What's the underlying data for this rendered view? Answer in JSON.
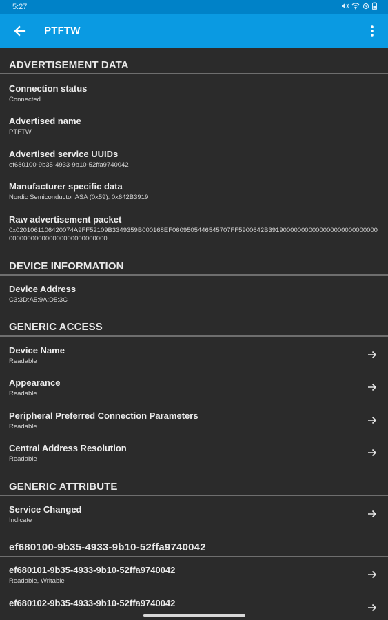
{
  "status_bar": {
    "time": "5:27"
  },
  "app_bar": {
    "title": "PTFTW"
  },
  "sections": {
    "advertisement": {
      "header": "ADVERTISEMENT DATA",
      "connection_status": {
        "title": "Connection status",
        "value": "Connected"
      },
      "advertised_name": {
        "title": "Advertised name",
        "value": "PTFTW"
      },
      "service_uuids": {
        "title": "Advertised service UUIDs",
        "value": "ef680100-9b35-4933-9b10-52ffa9740042"
      },
      "manufacturer_data": {
        "title": "Manufacturer specific data",
        "value": "Nordic Semiconductor ASA (0x59): 0x642B3919"
      },
      "raw_packet": {
        "title": "Raw advertisement packet",
        "value": "0x0201061106420074A9FF52109B3349359B000168EF0609505446545707FF5900642B391900000000000000000000000000000000000000000000000000000"
      }
    },
    "device_info": {
      "header": "DEVICE INFORMATION",
      "device_address": {
        "title": "Device Address",
        "value": "C3:3D:A5:9A:D5:3C"
      }
    },
    "generic_access": {
      "header": "GENERIC ACCESS",
      "items": [
        {
          "title": "Device Name",
          "value": "Readable"
        },
        {
          "title": "Appearance",
          "value": "Readable"
        },
        {
          "title": "Peripheral Preferred Connection Parameters",
          "value": "Readable"
        },
        {
          "title": "Central Address Resolution",
          "value": "Readable"
        }
      ]
    },
    "generic_attribute": {
      "header": "GENERIC ATTRIBUTE",
      "items": [
        {
          "title": "Service Changed",
          "value": "Indicate"
        }
      ]
    },
    "custom_service": {
      "header": "ef680100-9b35-4933-9b10-52ffa9740042",
      "items": [
        {
          "title": "ef680101-9b35-4933-9b10-52ffa9740042",
          "value": "Readable, Writable"
        },
        {
          "title": "ef680102-9b35-4933-9b10-52ffa9740042",
          "value": ""
        }
      ]
    }
  }
}
